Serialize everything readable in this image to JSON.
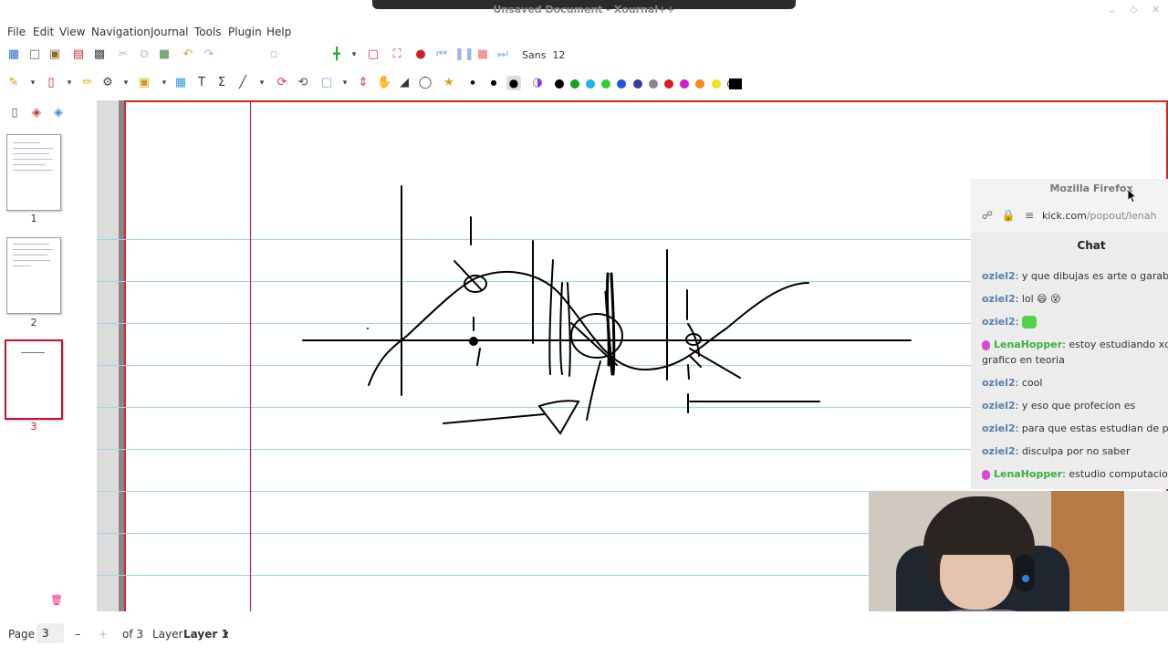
{
  "window": {
    "title": "Unsaved Document - Xournal++"
  },
  "menu": [
    "File",
    "Edit",
    "View",
    "Navigation",
    "Journal",
    "Tools",
    "Plugin",
    "Help"
  ],
  "toolbar": {
    "font": "Sans",
    "font_size": "12"
  },
  "colors": {
    "accent": "#c8102e",
    "palette": [
      "#000000",
      "#1a9e1a",
      "#1ab4e8",
      "#2fd02f",
      "#2255dd",
      "#3a3aa0",
      "#888888",
      "#e01b1b",
      "#d11ad1",
      "#f08a1c",
      "#f2e31b",
      "#ffffff"
    ]
  },
  "pages": [
    {
      "number": "1",
      "selected": false
    },
    {
      "number": "2",
      "selected": false
    },
    {
      "number": "3",
      "selected": true
    }
  ],
  "status": {
    "page_label": "Page",
    "page_value": "3",
    "of_total": "of 3",
    "layer_label": "Layer",
    "layer_value": "Layer 1"
  },
  "firefox": {
    "title": "Mozilla Firefox",
    "url_host": "kick.com",
    "url_path": "/popout/lenah"
  },
  "chat": {
    "heading": "Chat",
    "messages": [
      {
        "user": "oziel2",
        "text": ": y que dibujas es arte o garabato",
        "lena": false
      },
      {
        "user": "oziel2",
        "text": ": lol 😄 😵",
        "lena": false
      },
      {
        "user": "oziel2",
        "text": ":",
        "lena": false
      },
      {
        "user": "LenaHopper",
        "text": ": estoy estudiando xd e",
        "cont": "grafico en teoria",
        "lena": true
      },
      {
        "user": "oziel2",
        "text": ": cool",
        "lena": false
      },
      {
        "user": "oziel2",
        "text": ": y eso que profecion es",
        "lena": false
      },
      {
        "user": "oziel2",
        "text": ": para que estas estudian de profe",
        "lena": false
      },
      {
        "user": "oziel2",
        "text": ": disculpa por no saber",
        "lena": false
      },
      {
        "user": "LenaHopper",
        "text": ": estudio computacion,",
        "lena": true
      }
    ]
  }
}
